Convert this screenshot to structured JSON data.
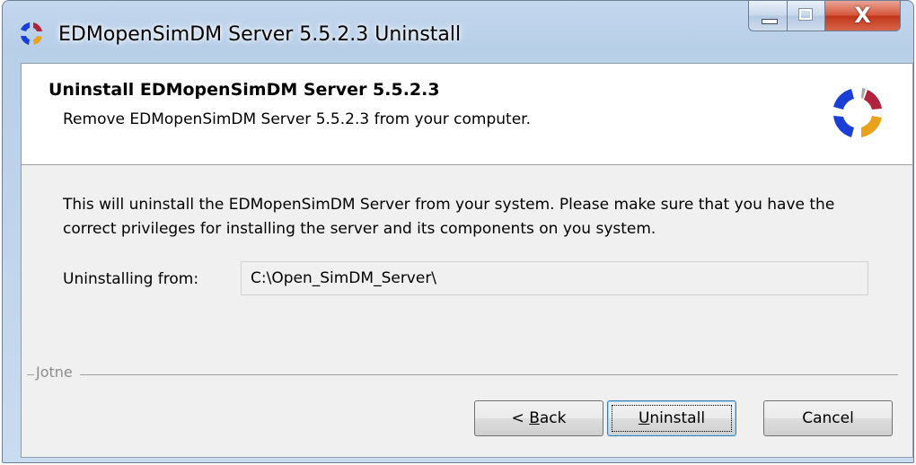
{
  "window": {
    "title": "EDMopenSimDM Server 5.5.2.3 Uninstall",
    "app_icon": "edm-logo-icon",
    "close_glyph": "X"
  },
  "header": {
    "title": "Uninstall EDMopenSimDM Server 5.5.2.3",
    "subtitle": "Remove EDMopenSimDM Server 5.5.2.3 from your computer.",
    "logo": "edm-logo-icon"
  },
  "body": {
    "description": "This will uninstall the EDMopenSimDM Server from your system. Please make sure that you have the correct privileges for installing the server and its components on you system.",
    "uninstall_from_label": "Uninstalling from:",
    "uninstall_from_value": "C:\\Open_SimDM_Server\\"
  },
  "branding": {
    "text": "Jotne"
  },
  "buttons": {
    "back_prefix": "< ",
    "back_accel": "B",
    "back_rest": "ack",
    "uninstall_accel": "U",
    "uninstall_rest": "ninstall",
    "cancel": "Cancel"
  },
  "colors": {
    "logo_blue": "#1b3fd6",
    "logo_orange": "#e8a21c",
    "logo_red": "#b0233a",
    "logo_gray": "#a6a6a6"
  }
}
